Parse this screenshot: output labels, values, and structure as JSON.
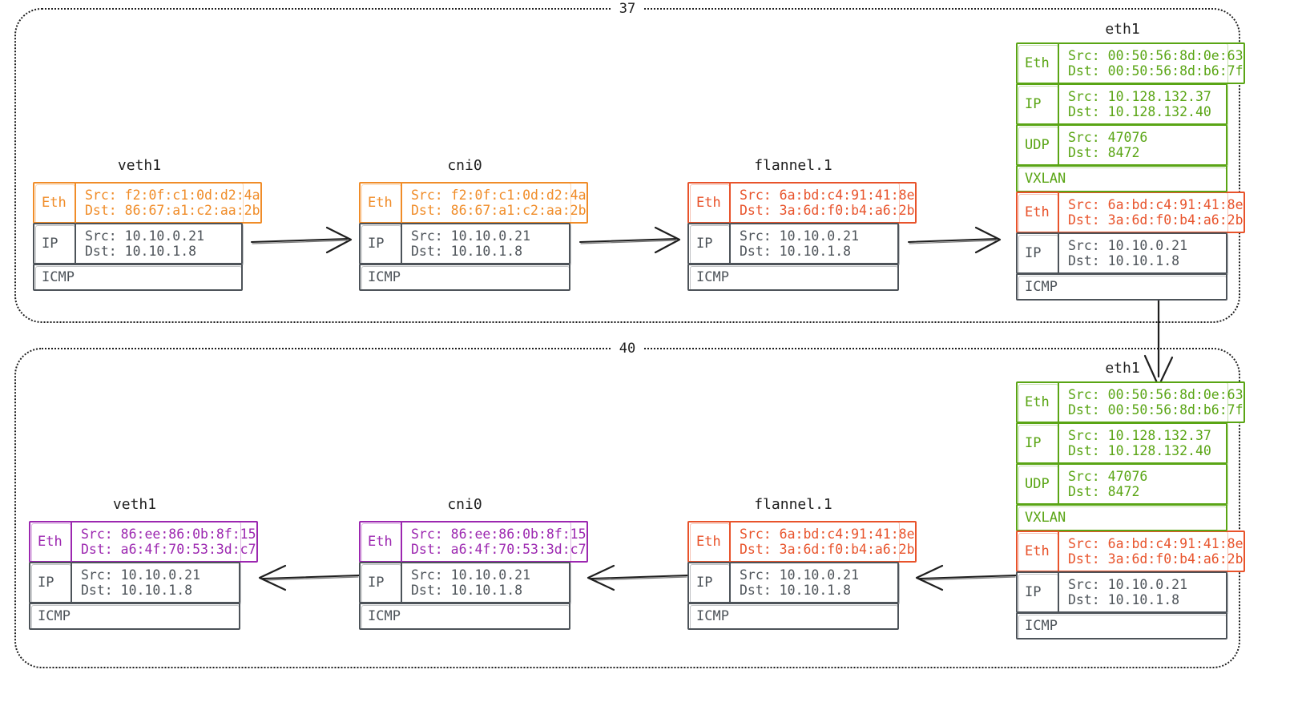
{
  "diagram": {
    "title": "flannel VXLAN packet walk",
    "colors": {
      "gray": "#4d5359",
      "orange": "#f08c28",
      "red": "#e8532b",
      "green": "#5aa515",
      "purple": "#9c27b0",
      "stroke": "#1e1e1e"
    }
  },
  "hosts": [
    {
      "label": "37"
    },
    {
      "label": "40"
    }
  ],
  "labels": {
    "veth1": "veth1",
    "cni0": "cni0",
    "flannel1": "flannel.1",
    "eth1": "eth1",
    "eth": "Eth",
    "ip": "IP",
    "udp": "UDP",
    "vxlan": "VXLAN",
    "icmp": "ICMP"
  },
  "packets": {
    "top_veth1": {
      "iface": "veth1",
      "eth": {
        "src": "Src: f2:0f:c1:0d:d2:4a",
        "dst": "Dst: 86:67:a1:c2:aa:2b"
      },
      "ip": {
        "src": "Src: 10.10.0.21",
        "dst": "Dst: 10.10.1.8"
      },
      "icmp": "ICMP"
    },
    "top_cni0": {
      "iface": "cni0",
      "eth": {
        "src": "Src: f2:0f:c1:0d:d2:4a",
        "dst": "Dst: 86:67:a1:c2:aa:2b"
      },
      "ip": {
        "src": "Src: 10.10.0.21",
        "dst": "Dst: 10.10.1.8"
      },
      "icmp": "ICMP"
    },
    "top_flannel1": {
      "iface": "flannel.1",
      "eth": {
        "src": "Src: 6a:bd:c4:91:41:8e",
        "dst": "Dst: 3a:6d:f0:b4:a6:2b"
      },
      "ip": {
        "src": "Src: 10.10.0.21",
        "dst": "Dst: 10.10.1.8"
      },
      "icmp": "ICMP"
    },
    "top_eth1": {
      "iface": "eth1",
      "outer_eth": {
        "src": "Src: 00:50:56:8d:0e:63",
        "dst": "Dst: 00:50:56:8d:b6:7f"
      },
      "outer_ip": {
        "src": "Src: 10.128.132.37",
        "dst": "Dst: 10.128.132.40"
      },
      "udp": {
        "src": "Src: 47076",
        "dst": "Dst: 8472"
      },
      "vxlan": "VXLAN",
      "inner_eth": {
        "src": "Src: 6a:bd:c4:91:41:8e",
        "dst": "Dst: 3a:6d:f0:b4:a6:2b"
      },
      "inner_ip": {
        "src": "Src: 10.10.0.21",
        "dst": "Dst: 10.10.1.8"
      },
      "icmp": "ICMP"
    },
    "bottom_eth1": {
      "iface": "eth1",
      "outer_eth": {
        "src": "Src: 00:50:56:8d:0e:63",
        "dst": "Dst: 00:50:56:8d:b6:7f"
      },
      "outer_ip": {
        "src": "Src: 10.128.132.37",
        "dst": "Dst: 10.128.132.40"
      },
      "udp": {
        "src": "Src: 47076",
        "dst": "Dst: 8472"
      },
      "vxlan": "VXLAN",
      "inner_eth": {
        "src": "Src: 6a:bd:c4:91:41:8e",
        "dst": "Dst: 3a:6d:f0:b4:a6:2b"
      },
      "inner_ip": {
        "src": "Src: 10.10.0.21",
        "dst": "Dst: 10.10.1.8"
      },
      "icmp": "ICMP"
    },
    "bottom_flannel1": {
      "iface": "flannel.1",
      "eth": {
        "src": "Src: 6a:bd:c4:91:41:8e",
        "dst": "Dst: 3a:6d:f0:b4:a6:2b"
      },
      "ip": {
        "src": "Src: 10.10.0.21",
        "dst": "Dst: 10.10.1.8"
      },
      "icmp": "ICMP"
    },
    "bottom_cni0": {
      "iface": "cni0",
      "eth": {
        "src": "Src: 86:ee:86:0b:8f:15",
        "dst": "Dst: a6:4f:70:53:3d:c7"
      },
      "ip": {
        "src": "Src: 10.10.0.21",
        "dst": "Dst: 10.10.1.8"
      },
      "icmp": "ICMP"
    },
    "bottom_veth1": {
      "iface": "veth1",
      "eth": {
        "src": "Src: 86:ee:86:0b:8f:15",
        "dst": "Dst: a6:4f:70:53:3d:c7"
      },
      "ip": {
        "src": "Src: 10.10.0.21",
        "dst": "Dst: 10.10.1.8"
      },
      "icmp": "ICMP"
    }
  }
}
